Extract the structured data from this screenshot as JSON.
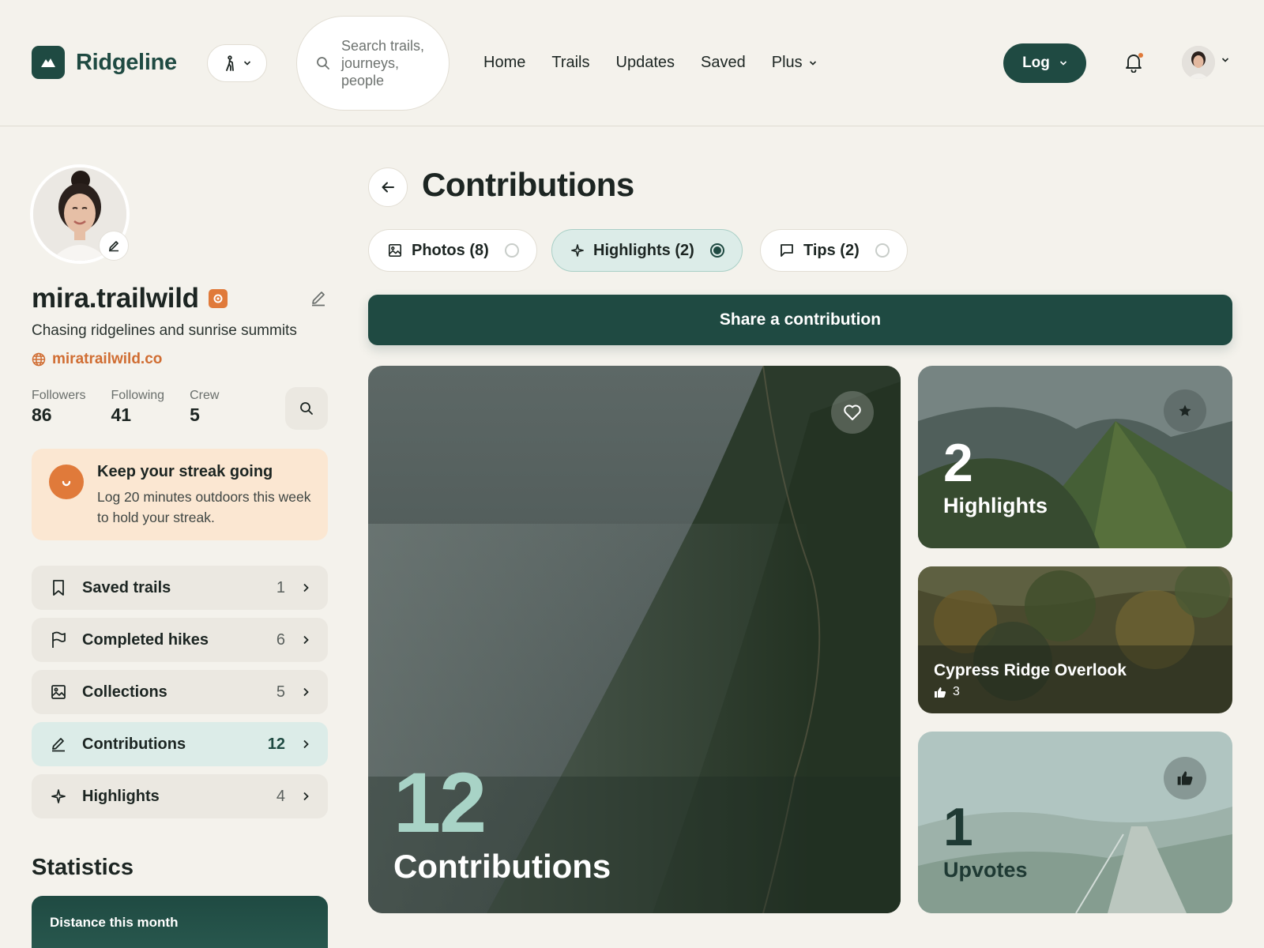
{
  "app": {
    "name": "Ridgeline"
  },
  "header": {
    "search_placeholder": "Search trails, journeys, people",
    "nav": [
      {
        "label": "Home"
      },
      {
        "label": "Trails"
      },
      {
        "label": "Updates"
      },
      {
        "label": "Saved"
      },
      {
        "label": "Plus",
        "has_dropdown": true
      }
    ],
    "log_label": "Log"
  },
  "profile": {
    "username": "mira.trailwild",
    "bio": "Chasing ridgelines and sunrise summits",
    "website": "miratrailwild.co",
    "stats": [
      {
        "label": "Followers",
        "value": "86"
      },
      {
        "label": "Following",
        "value": "41"
      },
      {
        "label": "Crew",
        "value": "5"
      }
    ]
  },
  "streak": {
    "title": "Keep your streak going",
    "text": "Log 20 minutes outdoors this week to hold your streak."
  },
  "menu": [
    {
      "label": "Saved trails",
      "count": "1",
      "icon": "bookmark-icon"
    },
    {
      "label": "Completed hikes",
      "count": "6",
      "icon": "flag-icon"
    },
    {
      "label": "Collections",
      "count": "5",
      "icon": "image-icon"
    },
    {
      "label": "Contributions",
      "count": "12",
      "icon": "pencil-icon",
      "active": true
    },
    {
      "label": "Highlights",
      "count": "4",
      "icon": "sparkle-icon"
    }
  ],
  "statistics": {
    "title": "Statistics",
    "distance_label": "Distance this month"
  },
  "main": {
    "title": "Contributions",
    "tabs": [
      {
        "label": "Photos (8)",
        "icon": "image-icon",
        "selected": false
      },
      {
        "label": "Highlights (2)",
        "icon": "sparkle-icon",
        "selected": true
      },
      {
        "label": "Tips (2)",
        "icon": "comment-icon",
        "selected": false
      }
    ],
    "share_label": "Share a contribution",
    "cards": {
      "contributions": {
        "number": "12",
        "label": "Contributions"
      },
      "highlights": {
        "number": "2",
        "label": "Highlights"
      },
      "featured": {
        "title": "Cypress Ridge Overlook",
        "upvotes": "3"
      },
      "upvotes": {
        "number": "1",
        "label": "Upvotes"
      }
    }
  },
  "colors": {
    "brand": "#1f4a42",
    "accent": "#e07a3a",
    "background": "#f4f2ec",
    "active_tint": "#dcece8",
    "streak_bg": "#fbe7d2"
  }
}
